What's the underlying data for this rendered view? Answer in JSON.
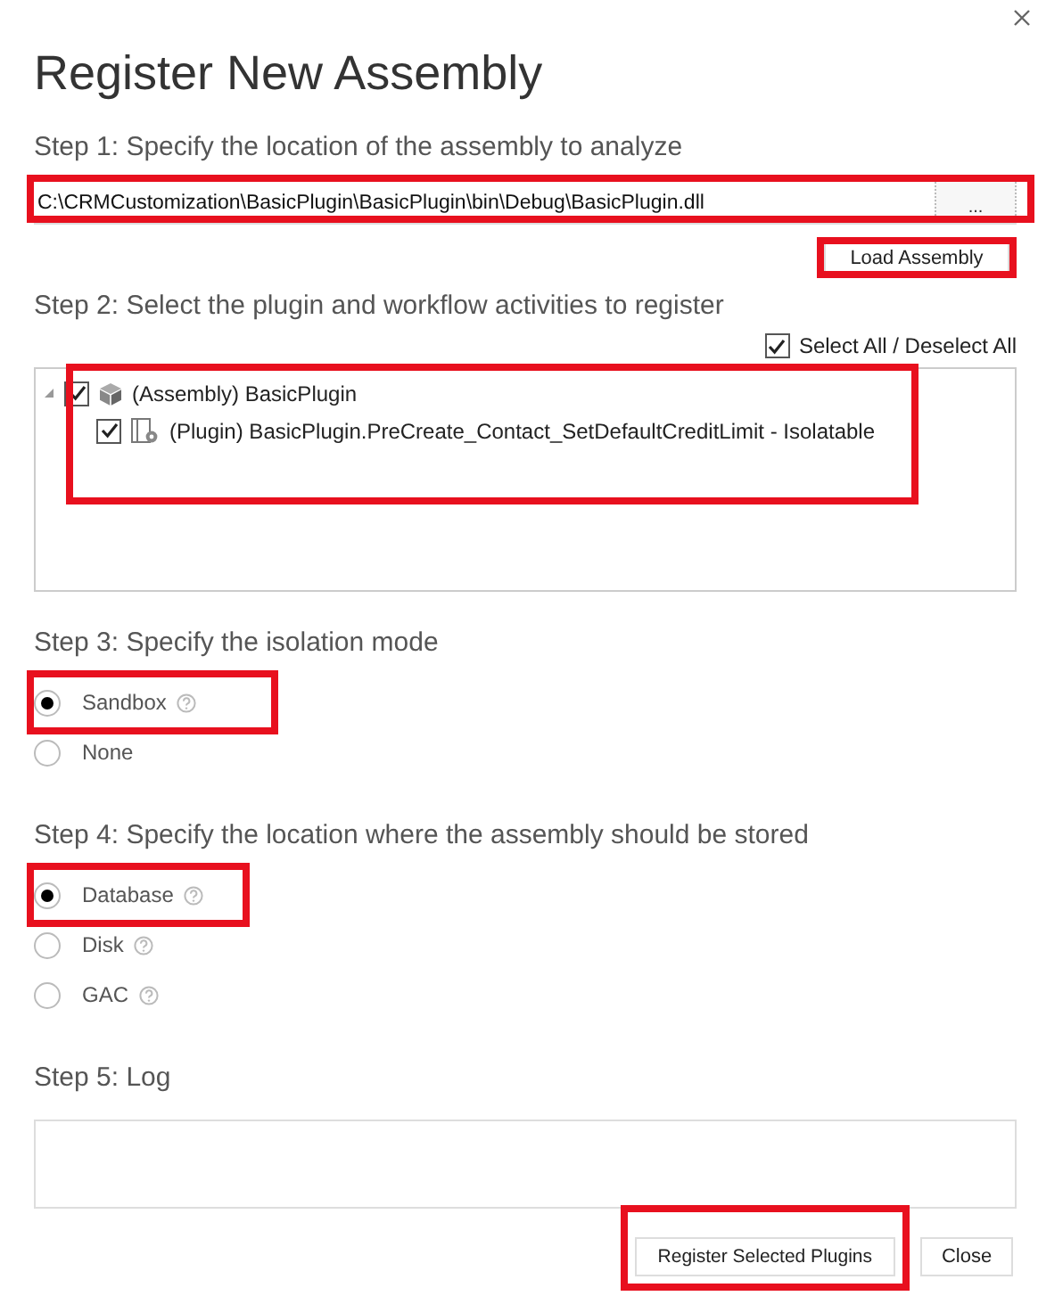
{
  "window": {
    "title": "Register New Assembly"
  },
  "step1": {
    "label": "Step 1: Specify the location of the assembly to analyze",
    "path": "C:\\CRMCustomization\\BasicPlugin\\BasicPlugin\\bin\\Debug\\BasicPlugin.dll",
    "browse": "...",
    "load_button": "Load Assembly"
  },
  "step2": {
    "label": "Step 2: Select the plugin and workflow activities to register",
    "select_all": {
      "label": "Select All / Deselect All",
      "checked": true
    },
    "tree": [
      {
        "kind": "assembly",
        "label": "(Assembly) BasicPlugin",
        "checked": true,
        "expanded": true,
        "children": [
          {
            "kind": "plugin",
            "label": "(Plugin) BasicPlugin.PreCreate_Contact_SetDefaultCreditLimit - Isolatable",
            "checked": true
          }
        ]
      }
    ]
  },
  "step3": {
    "label": "Step 3: Specify the isolation mode",
    "options": [
      {
        "label": "Sandbox",
        "selected": true,
        "help": true,
        "highlighted": true
      },
      {
        "label": "None",
        "selected": false,
        "help": false,
        "highlighted": false
      }
    ]
  },
  "step4": {
    "label": "Step 4: Specify the location where the assembly should be stored",
    "options": [
      {
        "label": "Database",
        "selected": true,
        "help": true,
        "highlighted": true
      },
      {
        "label": "Disk",
        "selected": false,
        "help": true,
        "highlighted": false
      },
      {
        "label": "GAC",
        "selected": false,
        "help": true,
        "highlighted": false
      }
    ]
  },
  "step5": {
    "label": "Step 5: Log"
  },
  "buttons": [
    "Register Selected Plugins",
    "Close"
  ]
}
